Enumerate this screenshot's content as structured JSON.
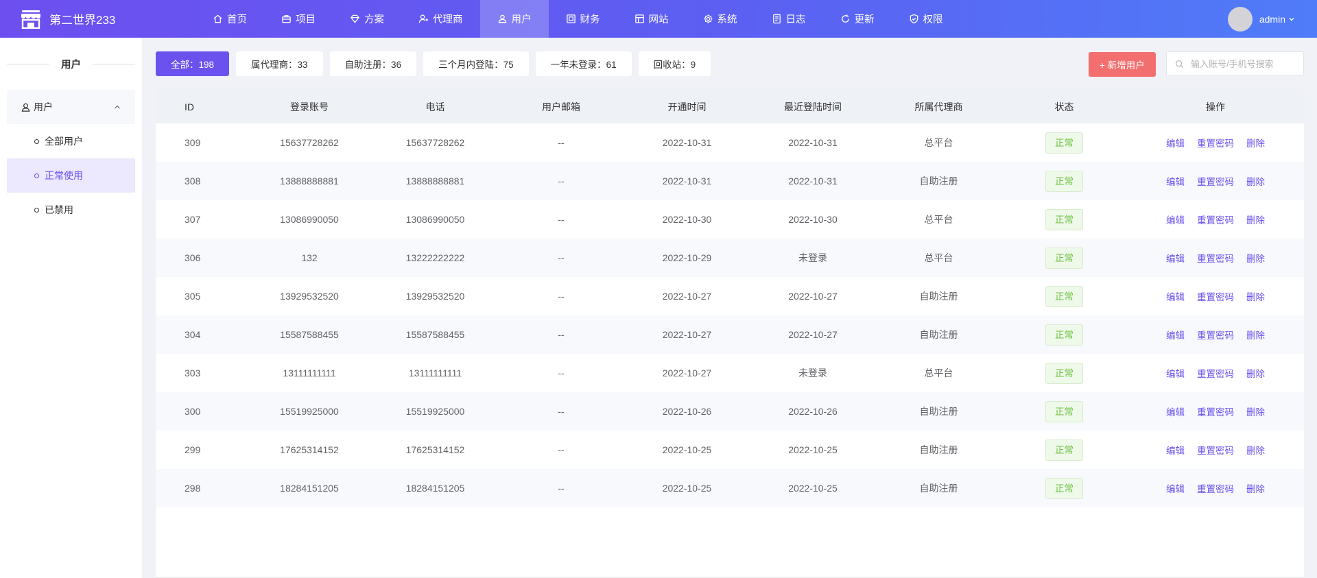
{
  "brand": {
    "name": "第二世界233"
  },
  "nav": [
    {
      "label": "首页",
      "icon": "home-icon"
    },
    {
      "label": "项目",
      "icon": "briefcase-icon"
    },
    {
      "label": "方案",
      "icon": "diamond-icon"
    },
    {
      "label": "代理商",
      "icon": "agent-icon"
    },
    {
      "label": "用户",
      "icon": "user-icon",
      "active": true
    },
    {
      "label": "财务",
      "icon": "finance-icon"
    },
    {
      "label": "网站",
      "icon": "website-icon"
    },
    {
      "label": "系统",
      "icon": "gear-icon"
    },
    {
      "label": "日志",
      "icon": "log-icon"
    },
    {
      "label": "更新",
      "icon": "refresh-icon"
    },
    {
      "label": "权限",
      "icon": "shield-icon"
    }
  ],
  "user": {
    "name": "admin"
  },
  "sidebar": {
    "title": "用户",
    "group": {
      "label": "用户"
    },
    "items": [
      {
        "label": "全部用户"
      },
      {
        "label": "正常使用",
        "active": true
      },
      {
        "label": "已禁用"
      }
    ]
  },
  "filters": [
    {
      "label": "全部：198",
      "active": true
    },
    {
      "label": "属代理商：33"
    },
    {
      "label": "自助注册：36"
    },
    {
      "label": "三个月内登陆：75"
    },
    {
      "label": "一年未登录：61"
    },
    {
      "label": "回收站：9"
    }
  ],
  "toolbar": {
    "add_label": "+ 新增用户",
    "search_placeholder": "输入账号/手机号搜索"
  },
  "table": {
    "headers": [
      "ID",
      "登录账号",
      "电话",
      "用户邮箱",
      "开通时间",
      "最近登陆时间",
      "所属代理商",
      "状态",
      "操作"
    ],
    "ops": [
      "编辑",
      "重置密码",
      "删除"
    ],
    "rows": [
      {
        "id": "309",
        "account": "15637728262",
        "phone": "15637728262",
        "email": "--",
        "opened": "2022-10-31",
        "last_login": "2022-10-31",
        "agent": "总平台",
        "status": "正常"
      },
      {
        "id": "308",
        "account": "13888888881",
        "phone": "13888888881",
        "email": "--",
        "opened": "2022-10-31",
        "last_login": "2022-10-31",
        "agent": "自助注册",
        "status": "正常"
      },
      {
        "id": "307",
        "account": "13086990050",
        "phone": "13086990050",
        "email": "--",
        "opened": "2022-10-30",
        "last_login": "2022-10-30",
        "agent": "总平台",
        "status": "正常"
      },
      {
        "id": "306",
        "account": "132",
        "phone": "13222222222",
        "email": "--",
        "opened": "2022-10-29",
        "last_login": "未登录",
        "agent": "总平台",
        "status": "正常"
      },
      {
        "id": "305",
        "account": "13929532520",
        "phone": "13929532520",
        "email": "--",
        "opened": "2022-10-27",
        "last_login": "2022-10-27",
        "agent": "自助注册",
        "status": "正常"
      },
      {
        "id": "304",
        "account": "15587588455",
        "phone": "15587588455",
        "email": "--",
        "opened": "2022-10-27",
        "last_login": "2022-10-27",
        "agent": "自助注册",
        "status": "正常"
      },
      {
        "id": "303",
        "account": "13111111111",
        "phone": "13111111111",
        "email": "--",
        "opened": "2022-10-27",
        "last_login": "未登录",
        "agent": "总平台",
        "status": "正常"
      },
      {
        "id": "300",
        "account": "15519925000",
        "phone": "15519925000",
        "email": "--",
        "opened": "2022-10-26",
        "last_login": "2022-10-26",
        "agent": "自助注册",
        "status": "正常"
      },
      {
        "id": "299",
        "account": "17625314152",
        "phone": "17625314152",
        "email": "--",
        "opened": "2022-10-25",
        "last_login": "2022-10-25",
        "agent": "自助注册",
        "status": "正常"
      },
      {
        "id": "298",
        "account": "18284151205",
        "phone": "18284151205",
        "email": "--",
        "opened": "2022-10-25",
        "last_login": "2022-10-25",
        "agent": "自助注册",
        "status": "正常"
      }
    ]
  }
}
